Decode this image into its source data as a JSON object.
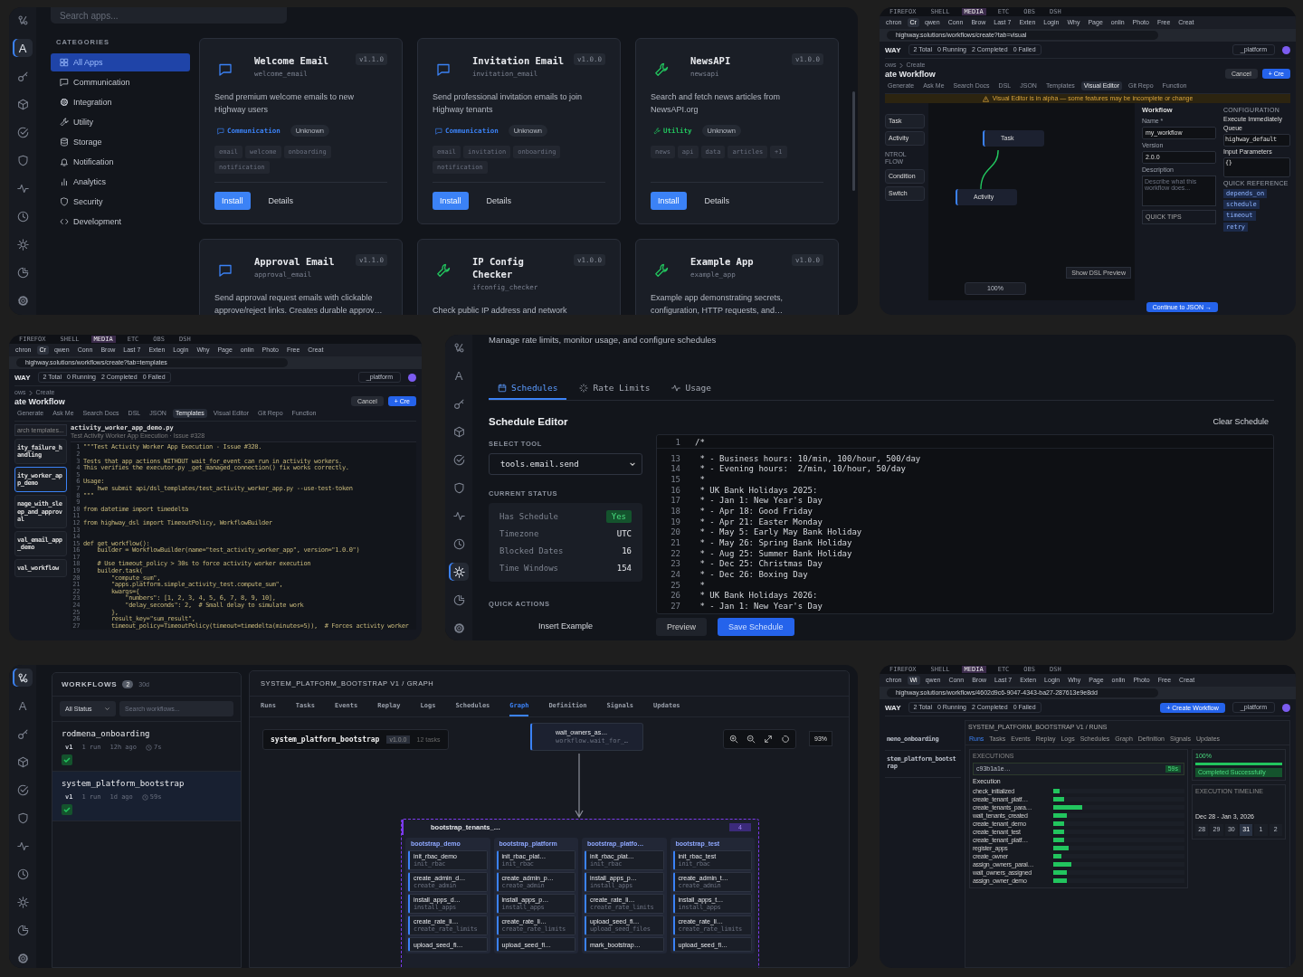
{
  "app_catalog": {
    "rail": [
      {
        "kind": "workflows",
        "selected": false
      },
      {
        "kind": "apps",
        "label": "A",
        "selected": true
      },
      {
        "kind": "key",
        "selected": false
      },
      {
        "kind": "cube",
        "selected": false
      },
      {
        "kind": "check",
        "selected": false
      },
      {
        "kind": "shield",
        "selected": false
      },
      {
        "kind": "pulse",
        "selected": false
      },
      {
        "kind": "clock",
        "selected": false
      },
      {
        "kind": "sun",
        "selected": false
      },
      {
        "kind": "pie",
        "selected": false
      },
      {
        "kind": "gear",
        "selected": false
      }
    ],
    "search": {
      "placeholder": "Search apps..."
    },
    "categories_heading": "CATEGORIES",
    "categories": [
      {
        "kind": "grid",
        "label": "All Apps",
        "selected": true
      },
      {
        "kind": "chat",
        "label": "Communication",
        "selected": false
      },
      {
        "kind": "gear",
        "label": "Integration",
        "selected": false
      },
      {
        "kind": "wrench",
        "label": "Utility",
        "selected": false
      },
      {
        "kind": "database",
        "label": "Storage",
        "selected": false
      },
      {
        "kind": "bell",
        "label": "Notification",
        "selected": false
      },
      {
        "kind": "bars",
        "label": "Analytics",
        "selected": false
      },
      {
        "kind": "shield",
        "label": "Security",
        "selected": false
      },
      {
        "kind": "code",
        "label": "Development",
        "selected": false
      }
    ],
    "apps": [
      {
        "kind": "chat",
        "name": "Welcome Email",
        "slug": "welcome_email",
        "version": "v1.1.0",
        "description": "Send premium welcome emails to new Highway users",
        "category": "Communication",
        "color": "#3b82f6",
        "status": "Unknown",
        "tags": [
          "email",
          "welcome",
          "onboarding",
          "notification"
        ],
        "actions": [
          "Install",
          "Details"
        ]
      },
      {
        "kind": "chat",
        "name": "Invitation Email",
        "slug": "invitation_email",
        "version": "v1.0.0",
        "description": "Send professional invitation emails to join Highway tenants",
        "category": "Communication",
        "color": "#3b82f6",
        "status": "Unknown",
        "tags": [
          "email",
          "invitation",
          "onboarding",
          "notification"
        ],
        "actions": [
          "Install",
          "Details"
        ]
      },
      {
        "kind": "wrench",
        "name": "NewsAPI",
        "slug": "newsapi",
        "version": "v1.0.0",
        "description": "Search and fetch news articles from NewsAPI.org",
        "category": "Utility",
        "color": "#22c55e",
        "status": "Unknown",
        "tags": [
          "news",
          "api",
          "data",
          "articles",
          "+1"
        ],
        "actions": [
          "Install",
          "Details"
        ]
      },
      {
        "kind": "chat",
        "name": "Approval Email",
        "slug": "approval_email",
        "version": "v1.1.0",
        "description": "Send approval request emails with clickable approve/reject links. Creates durable approv…"
      },
      {
        "kind": "wrench",
        "name": "IP Config Checker",
        "slug": "ifconfig_checker",
        "version": "v1.0.0",
        "description": "Check public IP address and network"
      },
      {
        "kind": "wrench",
        "name": "Example App",
        "slug": "example_app",
        "version": "v1.0.0",
        "description": "Example app demonstrating secrets, configuration, HTTP requests, and…"
      }
    ]
  },
  "workflow_editor": {
    "browser": {
      "workspaces": [
        {
          "label": "FIREFOX",
          "selected": false
        },
        {
          "label": "SHELL",
          "selected": false
        },
        {
          "label": "MEDIA",
          "selected": true
        },
        {
          "label": "ETC",
          "selected": false
        },
        {
          "label": "OBS",
          "selected": false
        },
        {
          "label": "DSH",
          "selected": false
        }
      ],
      "tabs": [
        {
          "label": "chron",
          "selected": false
        },
        {
          "label": "Cr",
          "selected": true
        },
        {
          "label": "qwen",
          "selected": false
        },
        {
          "label": "Conn",
          "selected": false
        },
        {
          "label": "Brow",
          "selected": false
        },
        {
          "label": "Last 7",
          "selected": false
        },
        {
          "label": "Exten",
          "selected": false
        },
        {
          "label": "Login",
          "selected": false
        },
        {
          "label": "Why",
          "selected": false
        },
        {
          "label": "Page",
          "selected": false
        },
        {
          "label": "onlin",
          "selected": false
        },
        {
          "label": "Photo",
          "selected": false
        },
        {
          "label": "Free",
          "selected": false
        },
        {
          "label": "Creat",
          "selected": false
        }
      ],
      "url": "highway.solutions/workflows/create?tab=visual"
    },
    "brand": "WAY",
    "stats": [
      "2 Total",
      "0 Running",
      "2 Completed",
      "0 Failed"
    ],
    "tenant": "_platform",
    "breadcrumb": [
      "ows",
      "Create"
    ],
    "title": "ate Workflow",
    "buttons": [
      "Cancel",
      "+ Cre"
    ],
    "tabs": [
      {
        "label": "Generate",
        "selected": false
      },
      {
        "label": "Ask Me",
        "selected": false
      },
      {
        "label": "Search Docs",
        "selected": false
      },
      {
        "label": "DSL",
        "selected": false
      },
      {
        "label": "JSON",
        "selected": false
      },
      {
        "label": "Templates",
        "selected": false
      },
      {
        "label": "Visual Editor",
        "selected": true
      },
      {
        "label": "Git Repo",
        "selected": false
      },
      {
        "label": "Function",
        "selected": false
      }
    ],
    "banner": "Visual Editor is in alpha — some features may be incomplete or change",
    "palette": [
      {
        "kind": "item",
        "label": "Task"
      },
      {
        "kind": "item",
        "label": "Activity"
      },
      {
        "kind": "heading",
        "label": "NTROL FLOW"
      },
      {
        "kind": "item",
        "label": "Condition"
      },
      {
        "kind": "item",
        "label": "Switch"
      }
    ],
    "nodes": [
      "Task",
      "Activity"
    ],
    "zoom": "100%",
    "dsl_button": "Show DSL Preview",
    "form": {
      "title": "Workflow",
      "name_label": "Name *",
      "name": "my_workflow",
      "version_label": "Version",
      "version": "2.0.0",
      "description_label": "Description",
      "description_placeholder": "Describe what this workflow does...",
      "tips": "QUICK TIPS"
    },
    "config": {
      "title": "CONFIGURATION",
      "execute": "Execute Immediately",
      "queue_label": "Queue",
      "queue": "highway_default",
      "params_label": "Input Parameters",
      "params": "{}",
      "reference": "QUICK REFERENCE",
      "keywords": [
        "depends_on",
        "schedule",
        "timeout",
        "retry"
      ]
    },
    "continue_button": "Continue to JSON →"
  },
  "template_browser": {
    "browser": {
      "workspaces": [
        {
          "label": "FIREFOX",
          "selected": false
        },
        {
          "label": "SHELL",
          "selected": false
        },
        {
          "label": "MEDIA",
          "selected": true
        },
        {
          "label": "ETC",
          "selected": false
        },
        {
          "label": "OBS",
          "selected": false
        },
        {
          "label": "DSH",
          "selected": false
        }
      ],
      "tabs": [
        {
          "label": "chron",
          "selected": false
        },
        {
          "label": "Cr",
          "selected": true
        },
        {
          "label": "qwen",
          "selected": false
        },
        {
          "label": "Conn",
          "selected": false
        },
        {
          "label": "Brow",
          "selected": false
        },
        {
          "label": "Last 7",
          "selected": false
        },
        {
          "label": "Exten",
          "selected": false
        },
        {
          "label": "Login",
          "selected": false
        },
        {
          "label": "Why",
          "selected": false
        },
        {
          "label": "Page",
          "selected": false
        },
        {
          "label": "onlin",
          "selected": false
        },
        {
          "label": "Photo",
          "selected": false
        },
        {
          "label": "Free",
          "selected": false
        },
        {
          "label": "Creat",
          "selected": false
        }
      ],
      "url": "highway.solutions/workflows/create?tab=templates"
    },
    "brand": "WAY",
    "stats": [
      "2 Total",
      "0 Running",
      "2 Completed",
      "0 Failed"
    ],
    "tenant": "_platform",
    "breadcrumb": [
      "ows",
      "Create"
    ],
    "title": "ate Workflow",
    "buttons": [
      "Cancel",
      "+ Cre"
    ],
    "tabs": [
      {
        "label": "Generate",
        "selected": false
      },
      {
        "label": "Ask Me",
        "selected": false
      },
      {
        "label": "Search Docs",
        "selected": false
      },
      {
        "label": "DSL",
        "selected": false
      },
      {
        "label": "JSON",
        "selected": false
      },
      {
        "label": "Templates",
        "selected": true
      },
      {
        "label": "Visual Editor",
        "selected": false
      },
      {
        "label": "Git Repo",
        "selected": false
      },
      {
        "label": "Function",
        "selected": false
      }
    ],
    "search": {
      "placeholder": "arch templates..."
    },
    "templates": [
      {
        "name": "ity_failure_handling",
        "selected": false
      },
      {
        "name": "ity_worker_app_demo",
        "selected": true
      },
      {
        "name": "nage_with_sleep_and_approval",
        "selected": false
      },
      {
        "name": "val_email_app_demo",
        "selected": false
      },
      {
        "name": "val_workflow",
        "selected": false
      }
    ],
    "file": "activity_worker_app_demo.py",
    "file_subtitle": "Test Activity Worker App Execution · Issue #328",
    "code": [
      {
        "n": "1",
        "text": "\"\"\"Test Activity Worker App Execution - Issue #328."
      },
      {
        "n": "2"
      },
      {
        "n": "3",
        "text": "Tests that app actions WITHOUT wait_for_event can run in activity workers."
      },
      {
        "n": "4",
        "text": "This verifies the executor.py _get_managed_connection() fix works correctly."
      },
      {
        "n": "5"
      },
      {
        "n": "6",
        "text": "Usage:"
      },
      {
        "n": "7",
        "text": "    hwe submit api/dsl_templates/test_activity_worker_app.py --use-test-token"
      },
      {
        "n": "8",
        "text": "\"\"\""
      },
      {
        "n": "9"
      },
      {
        "n": "10",
        "text": "from datetime import timedelta"
      },
      {
        "n": "11"
      },
      {
        "n": "12",
        "text": "from highway_dsl import TimeoutPolicy, WorkflowBuilder"
      },
      {
        "n": "13"
      },
      {
        "n": "14"
      },
      {
        "n": "15",
        "text": "def get_workflow():"
      },
      {
        "n": "16",
        "text": "    builder = WorkflowBuilder(name=\"test_activity_worker_app\", version=\"1.0.0\")"
      },
      {
        "n": "17"
      },
      {
        "n": "18",
        "text": "    # Use timeout_policy > 30s to force activity worker execution"
      },
      {
        "n": "19",
        "text": "    builder.task("
      },
      {
        "n": "20",
        "text": "        \"compute_sum\","
      },
      {
        "n": "21",
        "text": "        \"apps.platform.simple_activity_test.compute_sum\","
      },
      {
        "n": "22",
        "text": "        kwargs={"
      },
      {
        "n": "23",
        "text": "            \"numbers\": [1, 2, 3, 4, 5, 6, 7, 8, 9, 10],"
      },
      {
        "n": "24",
        "text": "            \"delay_seconds\": 2,  # Small delay to simulate work"
      },
      {
        "n": "25",
        "text": "        },"
      },
      {
        "n": "26",
        "text": "        result_key=\"sum_result\","
      },
      {
        "n": "27",
        "text": "        timeout_policy=TimeoutPolicy(timeout=timedelta(minutes=5)),  # Forces activity worker"
      }
    ]
  },
  "schedules": {
    "rail": [
      {
        "kind": "workflows",
        "selected": false
      },
      {
        "kind": "apps",
        "label": "A",
        "selected": false
      },
      {
        "kind": "key",
        "selected": false
      },
      {
        "kind": "cube",
        "selected": false
      },
      {
        "kind": "check",
        "selected": false
      },
      {
        "kind": "shield",
        "selected": false
      },
      {
        "kind": "pulse",
        "selected": false
      },
      {
        "kind": "clock",
        "selected": false
      },
      {
        "kind": "sun",
        "selected": true
      },
      {
        "kind": "pie",
        "selected": false
      },
      {
        "kind": "gear",
        "selected": false
      }
    ],
    "subtitle": "Manage rate limits, monitor usage, and configure schedules",
    "tabs": [
      {
        "kind": "calendar",
        "label": "Schedules",
        "selected": true
      },
      {
        "kind": "spinner",
        "label": "Rate Limits",
        "selected": false
      },
      {
        "kind": "pulse",
        "label": "Usage",
        "selected": false
      }
    ],
    "editor_title": "Schedule Editor",
    "clear_button": "Clear Schedule",
    "tool_label": "SELECT TOOL",
    "tool": "tools.email.send",
    "status_label": "CURRENT STATUS",
    "status": [
      {
        "kind": "badge",
        "label": "Has Schedule",
        "value": "Yes"
      },
      {
        "kind": "plain",
        "label": "Timezone",
        "value": "UTC"
      },
      {
        "kind": "plain",
        "label": "Blocked Dates",
        "value": "16"
      },
      {
        "kind": "plain",
        "label": "Time Windows",
        "value": "154"
      }
    ],
    "actions_label": "QUICK ACTIONS",
    "action": "Insert Example",
    "code": [
      {
        "n": "1",
        "text": "/*"
      },
      {
        "n": "13",
        "text": " * - Business hours: 10/min, 100/hour, 500/day"
      },
      {
        "n": "14",
        "text": " * - Evening hours:  2/min, 10/hour, 50/day"
      },
      {
        "n": "15",
        "text": " *"
      },
      {
        "n": "16",
        "text": " * UK Bank Holidays 2025:"
      },
      {
        "n": "17",
        "text": " * - Jan 1: New Year's Day"
      },
      {
        "n": "18",
        "text": " * - Apr 18: Good Friday"
      },
      {
        "n": "19",
        "text": " * - Apr 21: Easter Monday"
      },
      {
        "n": "20",
        "text": " * - May 5: Early May Bank Holiday"
      },
      {
        "n": "21",
        "text": " * - May 26: Spring Bank Holiday"
      },
      {
        "n": "22",
        "text": " * - Aug 25: Summer Bank Holiday"
      },
      {
        "n": "23",
        "text": " * - Dec 25: Christmas Day"
      },
      {
        "n": "24",
        "text": " * - Dec 26: Boxing Day"
      },
      {
        "n": "25",
        "text": " *"
      },
      {
        "n": "26",
        "text": " * UK Bank Holidays 2026:"
      },
      {
        "n": "27",
        "text": " * - Jan 1: New Year's Day"
      }
    ],
    "buttons": [
      "Preview",
      "Save Schedule"
    ]
  },
  "workflows": {
    "rail": [
      {
        "kind": "workflows",
        "selected": true
      },
      {
        "kind": "apps",
        "label": "A",
        "selected": false
      },
      {
        "kind": "key",
        "selected": false
      },
      {
        "kind": "cube",
        "selected": false
      },
      {
        "kind": "check",
        "selected": false
      },
      {
        "kind": "shield",
        "selected": false
      },
      {
        "kind": "pulse",
        "selected": false
      },
      {
        "kind": "clock",
        "selected": false
      },
      {
        "kind": "sun",
        "selected": false
      },
      {
        "kind": "pie",
        "selected": false
      },
      {
        "kind": "gear",
        "selected": false
      }
    ],
    "title": "WORKFLOWS",
    "count": "2",
    "range": "30d",
    "status_filter": "All Status",
    "search": {
      "placeholder": "Search workflows..."
    },
    "items": [
      {
        "name": "rodmena_onboarding",
        "version": "v1",
        "runs": "1 run",
        "age": "12h ago",
        "duration": "7s",
        "selected": false
      },
      {
        "name": "system_platform_bootstrap",
        "version": "v1",
        "runs": "1 run",
        "age": "1d ago",
        "duration": "59s",
        "selected": true
      }
    ],
    "graph": {
      "title": "SYSTEM_PLATFORM_BOOTSTRAP V1 / GRAPH",
      "tabs": [
        {
          "label": "Runs",
          "selected": false
        },
        {
          "label": "Tasks",
          "selected": false
        },
        {
          "label": "Events",
          "selected": false
        },
        {
          "label": "Replay",
          "selected": false
        },
        {
          "label": "Logs",
          "selected": false
        },
        {
          "label": "Schedules",
          "selected": false
        },
        {
          "label": "Graph",
          "selected": true
        },
        {
          "label": "Definition",
          "selected": false
        },
        {
          "label": "Signals",
          "selected": false
        },
        {
          "label": "Updates",
          "selected": false
        }
      ],
      "workflow": "system_platform_bootstrap",
      "version": "v1.0.0",
      "tasks": "12 tasks",
      "zoom": "93%",
      "top_node": {
        "name": "wait_owners_as…",
        "subtitle": "workflow.wait_for_…"
      },
      "group": {
        "name": "bootstrap_tenants_…",
        "count": "4",
        "lanes": [
          {
            "name": "bootstrap_demo",
            "tasks": [
              {
                "name": "init_rbac_demo",
                "subtitle": "init_rbac"
              },
              {
                "name": "create_admin_d…",
                "subtitle": "create_admin"
              },
              {
                "name": "install_apps_d…",
                "subtitle": "install_apps"
              },
              {
                "name": "create_rate_li…",
                "subtitle": "create_rate_limits"
              },
              {
                "name": "upload_seed_fi…"
              }
            ]
          },
          {
            "name": "bootstrap_platform",
            "tasks": [
              {
                "name": "init_rbac_plat…",
                "subtitle": "init_rbac"
              },
              {
                "name": "create_admin_p…",
                "subtitle": "create_admin"
              },
              {
                "name": "install_apps_p…",
                "subtitle": "install_apps"
              },
              {
                "name": "create_rate_li…",
                "subtitle": "create_rate_limits"
              },
              {
                "name": "upload_seed_fi…"
              }
            ]
          },
          {
            "name": "bootstrap_platfo…",
            "tasks": [
              {
                "name": "init_rbac_plat…",
                "subtitle": "init_rbac"
              },
              {
                "name": "install_apps_p…",
                "subtitle": "install_apps"
              },
              {
                "name": "create_rate_li…",
                "subtitle": "create_rate_limits"
              },
              {
                "name": "upload_seed_fi…",
                "subtitle": "upload_seed_files"
              },
              {
                "name": "mark_bootstrap…"
              }
            ]
          },
          {
            "name": "bootstrap_test",
            "tasks": [
              {
                "name": "init_rbac_test",
                "subtitle": "init_rbac"
              },
              {
                "name": "create_admin_t…",
                "subtitle": "create_admin"
              },
              {
                "name": "install_apps_t…",
                "subtitle": "install_apps"
              },
              {
                "name": "create_rate_li…",
                "subtitle": "create_rate_limits"
              },
              {
                "name": "upload_seed_fi…"
              }
            ]
          }
        ]
      }
    }
  },
  "run_view": {
    "browser": {
      "workspaces": [
        {
          "label": "FIREFOX",
          "selected": false
        },
        {
          "label": "SHELL",
          "selected": false
        },
        {
          "label": "MEDIA",
          "selected": true
        },
        {
          "label": "ETC",
          "selected": false
        },
        {
          "label": "OBS",
          "selected": false
        },
        {
          "label": "DSH",
          "selected": false
        }
      ],
      "tabs": [
        {
          "label": "chron",
          "selected": false
        },
        {
          "label": "Wi",
          "selected": true
        },
        {
          "label": "qwen",
          "selected": false
        },
        {
          "label": "Conn",
          "selected": false
        },
        {
          "label": "Brow",
          "selected": false
        },
        {
          "label": "Last 7",
          "selected": false
        },
        {
          "label": "Exten",
          "selected": false
        },
        {
          "label": "Login",
          "selected": false
        },
        {
          "label": "Why",
          "selected": false
        },
        {
          "label": "Page",
          "selected": false
        },
        {
          "label": "onlin",
          "selected": false
        },
        {
          "label": "Photo",
          "selected": false
        },
        {
          "label": "Free",
          "selected": false
        },
        {
          "label": "Creat",
          "selected": false
        }
      ],
      "url": "highway.solutions/workflows/4602d9c6-9047-4343-ba27-287613e9e8dd"
    },
    "brand": "WAY",
    "stats": [
      "2 Total",
      "0 Running",
      "2 Completed",
      "0 Failed"
    ],
    "create_button": "+ Create Workflow",
    "tenant": "_platform",
    "list": [
      "meno_onboarding",
      "stem_platform_bootstrap"
    ],
    "title": "SYSTEM_PLATFORM_BOOTSTRAP V1 / RUNS",
    "tabs": [
      {
        "label": "Runs",
        "selected": true
      },
      {
        "label": "Tasks",
        "selected": false
      },
      {
        "label": "Events",
        "selected": false
      },
      {
        "label": "Replay",
        "selected": false
      },
      {
        "label": "Logs",
        "selected": false
      },
      {
        "label": "Schedules",
        "selected": false
      },
      {
        "label": "Graph",
        "selected": false
      },
      {
        "label": "Definition",
        "selected": false
      },
      {
        "label": "Signals",
        "selected": false
      },
      {
        "label": "Updates",
        "selected": false
      }
    ],
    "executions_label": "EXECUTIONS",
    "execution": "c93b1a1e…",
    "execution_status": "59s",
    "gantt_label": "Execution",
    "gantt": [
      {
        "name": "check_initialized",
        "level": 0.05
      },
      {
        "name": "create_tenant_platf…",
        "level": 0.08
      },
      {
        "name": "create_tenants_para…",
        "level": 0.22
      },
      {
        "name": "wait_tenants_created",
        "level": 0.1
      },
      {
        "name": "create_tenant_demo",
        "level": 0.08
      },
      {
        "name": "create_tenant_test",
        "level": 0.08
      },
      {
        "name": "create_tenant_platf…",
        "level": 0.08
      },
      {
        "name": "register_apps",
        "level": 0.12
      },
      {
        "name": "create_owner",
        "level": 0.06
      },
      {
        "name": "assign_owners_paral…",
        "level": 0.14
      },
      {
        "name": "wait_owners_assigned",
        "level": 0.1
      },
      {
        "name": "assign_owner_demo",
        "level": 0.1
      }
    ],
    "progress_label": "100%",
    "progress": {
      "level": 1
    },
    "result": "Completed Successfully",
    "timeline_label": "EXECUTION TIMELINE",
    "week": "Dec 28 - Jan 3, 2026",
    "days": [
      {
        "day": "28",
        "selected": false
      },
      {
        "day": "29",
        "selected": false
      },
      {
        "day": "30",
        "selected": false
      },
      {
        "day": "31",
        "selected": true
      },
      {
        "day": "1",
        "selected": false
      },
      {
        "day": "2",
        "selected": false
      }
    ]
  }
}
